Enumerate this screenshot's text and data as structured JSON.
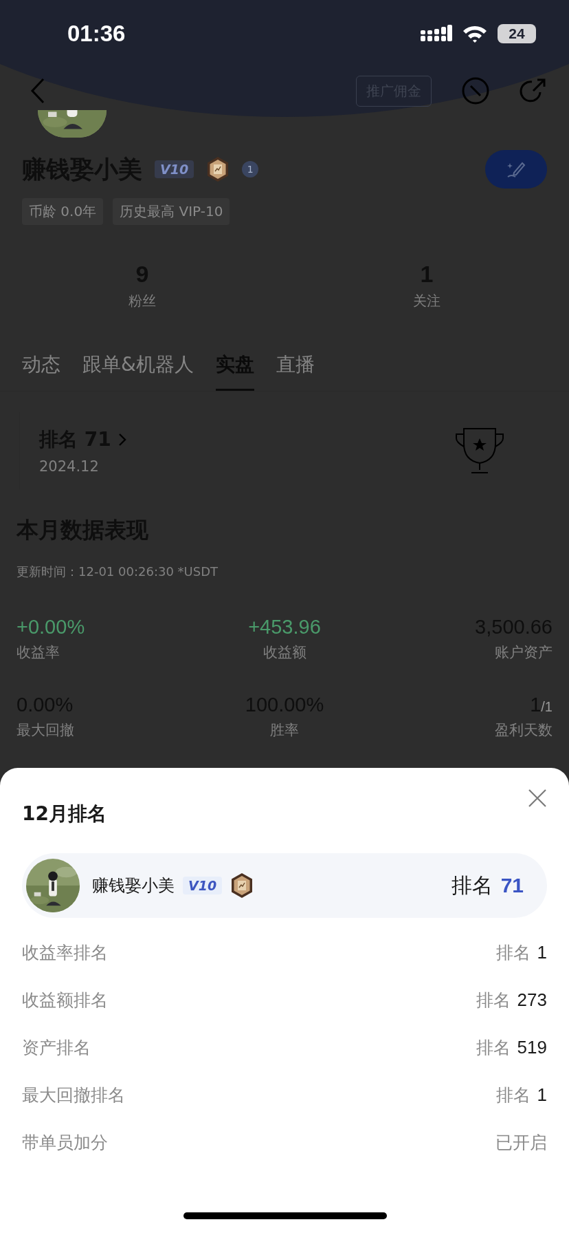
{
  "status_bar": {
    "time": "01:36",
    "battery": "24"
  },
  "nav": {
    "promo_button": "推广佣金"
  },
  "profile": {
    "name": "赚钱娶小美",
    "vip_badge": "V10",
    "level_badge": "1",
    "tags": [
      "币龄 0.0年",
      "历史最高 VIP-10"
    ],
    "stats": [
      {
        "value": "9",
        "label": "粉丝"
      },
      {
        "value": "1",
        "label": "关注"
      }
    ]
  },
  "tabs": [
    {
      "label": "动态",
      "selected": false
    },
    {
      "label": "跟单&机器人",
      "selected": false
    },
    {
      "label": "实盘",
      "selected": true
    },
    {
      "label": "直播",
      "selected": false
    }
  ],
  "rank_card": {
    "title": "排名 71",
    "date": "2024.12"
  },
  "monthly": {
    "title": "本月数据表现",
    "updated": "更新时间：12-01 00:26:30 *USDT",
    "metrics": [
      {
        "value": "+0.00%",
        "label": "收益率",
        "kind": "gain"
      },
      {
        "value": "+453.96",
        "label": "收益额",
        "kind": "gain"
      },
      {
        "value": "3,500.66",
        "label": "账户资产",
        "kind": "plain"
      },
      {
        "value": "0.00%",
        "label": "最大回撤",
        "kind": "plain"
      },
      {
        "value": "100.00%",
        "label": "胜率",
        "kind": "plain"
      },
      {
        "value": "1",
        "total": "/1",
        "label": "盈利天数",
        "kind": "plain"
      }
    ]
  },
  "sheet": {
    "title": "12月排名",
    "user": {
      "name": "赚钱娶小美",
      "vip_badge": "V10",
      "rank_prefix": "排名",
      "rank": "71"
    },
    "rows": [
      {
        "label": "收益率排名",
        "prefix": "排名",
        "value": "1",
        "kind": "rank"
      },
      {
        "label": "收益额排名",
        "prefix": "排名",
        "value": "273",
        "kind": "rank"
      },
      {
        "label": "资产排名",
        "prefix": "排名",
        "value": "519",
        "kind": "rank"
      },
      {
        "label": "最大回撤排名",
        "prefix": "排名",
        "value": "1",
        "kind": "rank"
      },
      {
        "label": "带单员加分",
        "value": "已开启",
        "kind": "status"
      }
    ]
  }
}
